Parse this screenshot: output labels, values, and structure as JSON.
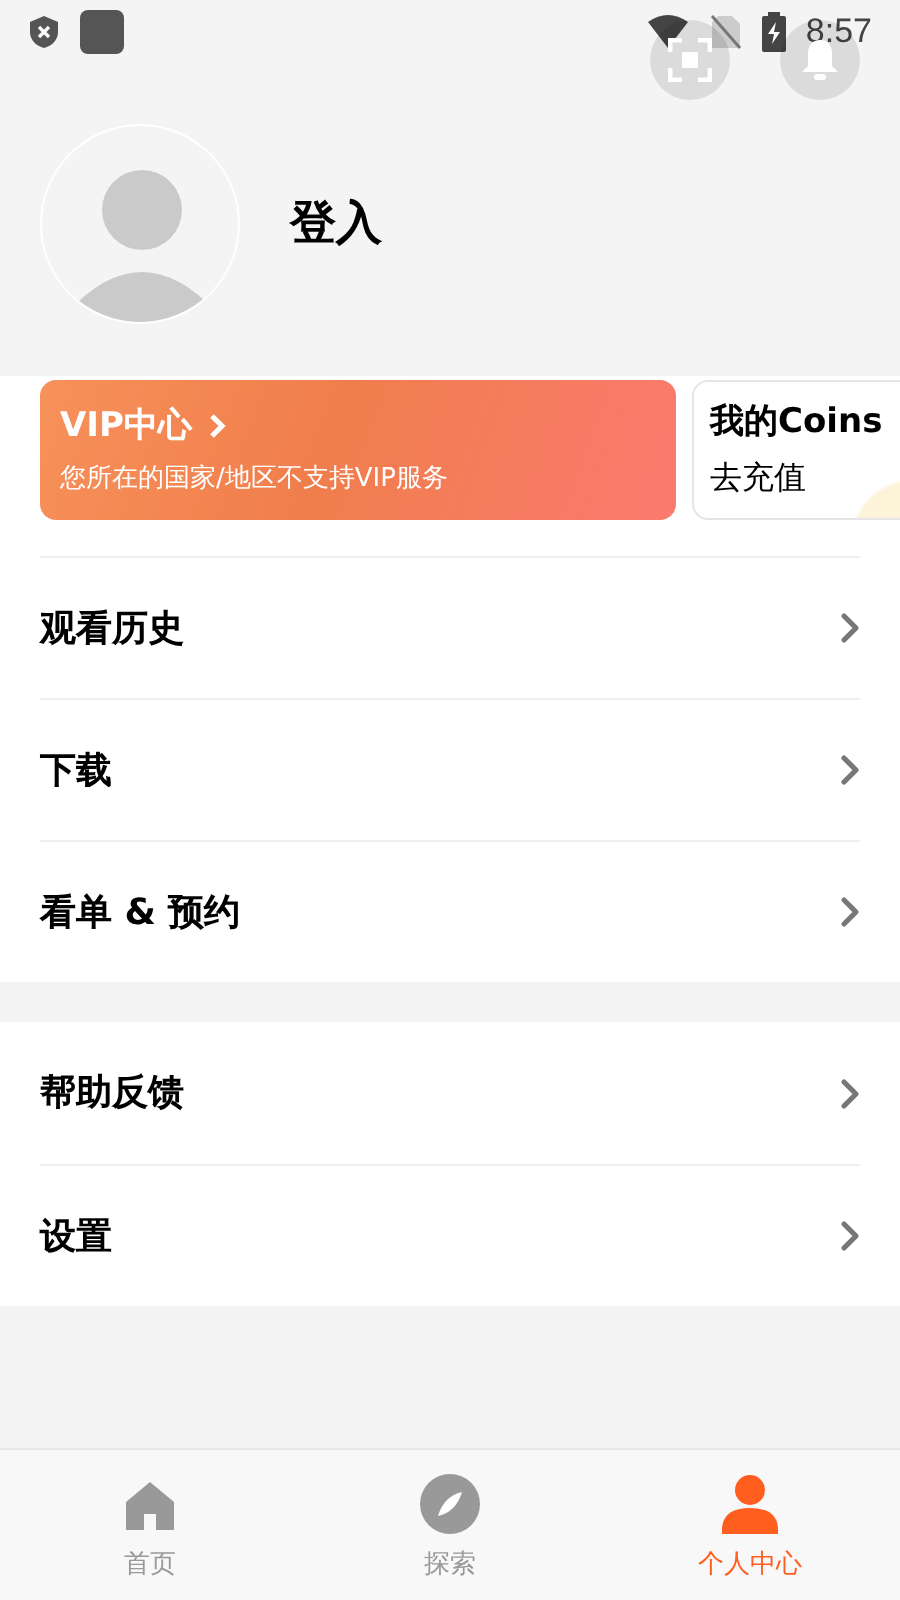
{
  "status_bar": {
    "time": "8:57"
  },
  "profile": {
    "login_label": "登入"
  },
  "vip_card": {
    "title": "VIP中心",
    "subtitle": "您所在的国家/地区不支持VIP服务"
  },
  "coins_card": {
    "title": "我的Coins",
    "action": "去充值"
  },
  "menu_groups": [
    {
      "items": [
        {
          "label": "观看历史"
        },
        {
          "label": "下载"
        },
        {
          "label": "看单 & 预约"
        }
      ]
    },
    {
      "items": [
        {
          "label": "帮助反馈"
        },
        {
          "label": "设置"
        }
      ]
    }
  ],
  "bottom_nav": [
    {
      "label": "首页",
      "kind": "home",
      "selected": false
    },
    {
      "label": "探索",
      "kind": "explore",
      "selected": false
    },
    {
      "label": "个人中心",
      "kind": "profile",
      "selected": true
    }
  ]
}
